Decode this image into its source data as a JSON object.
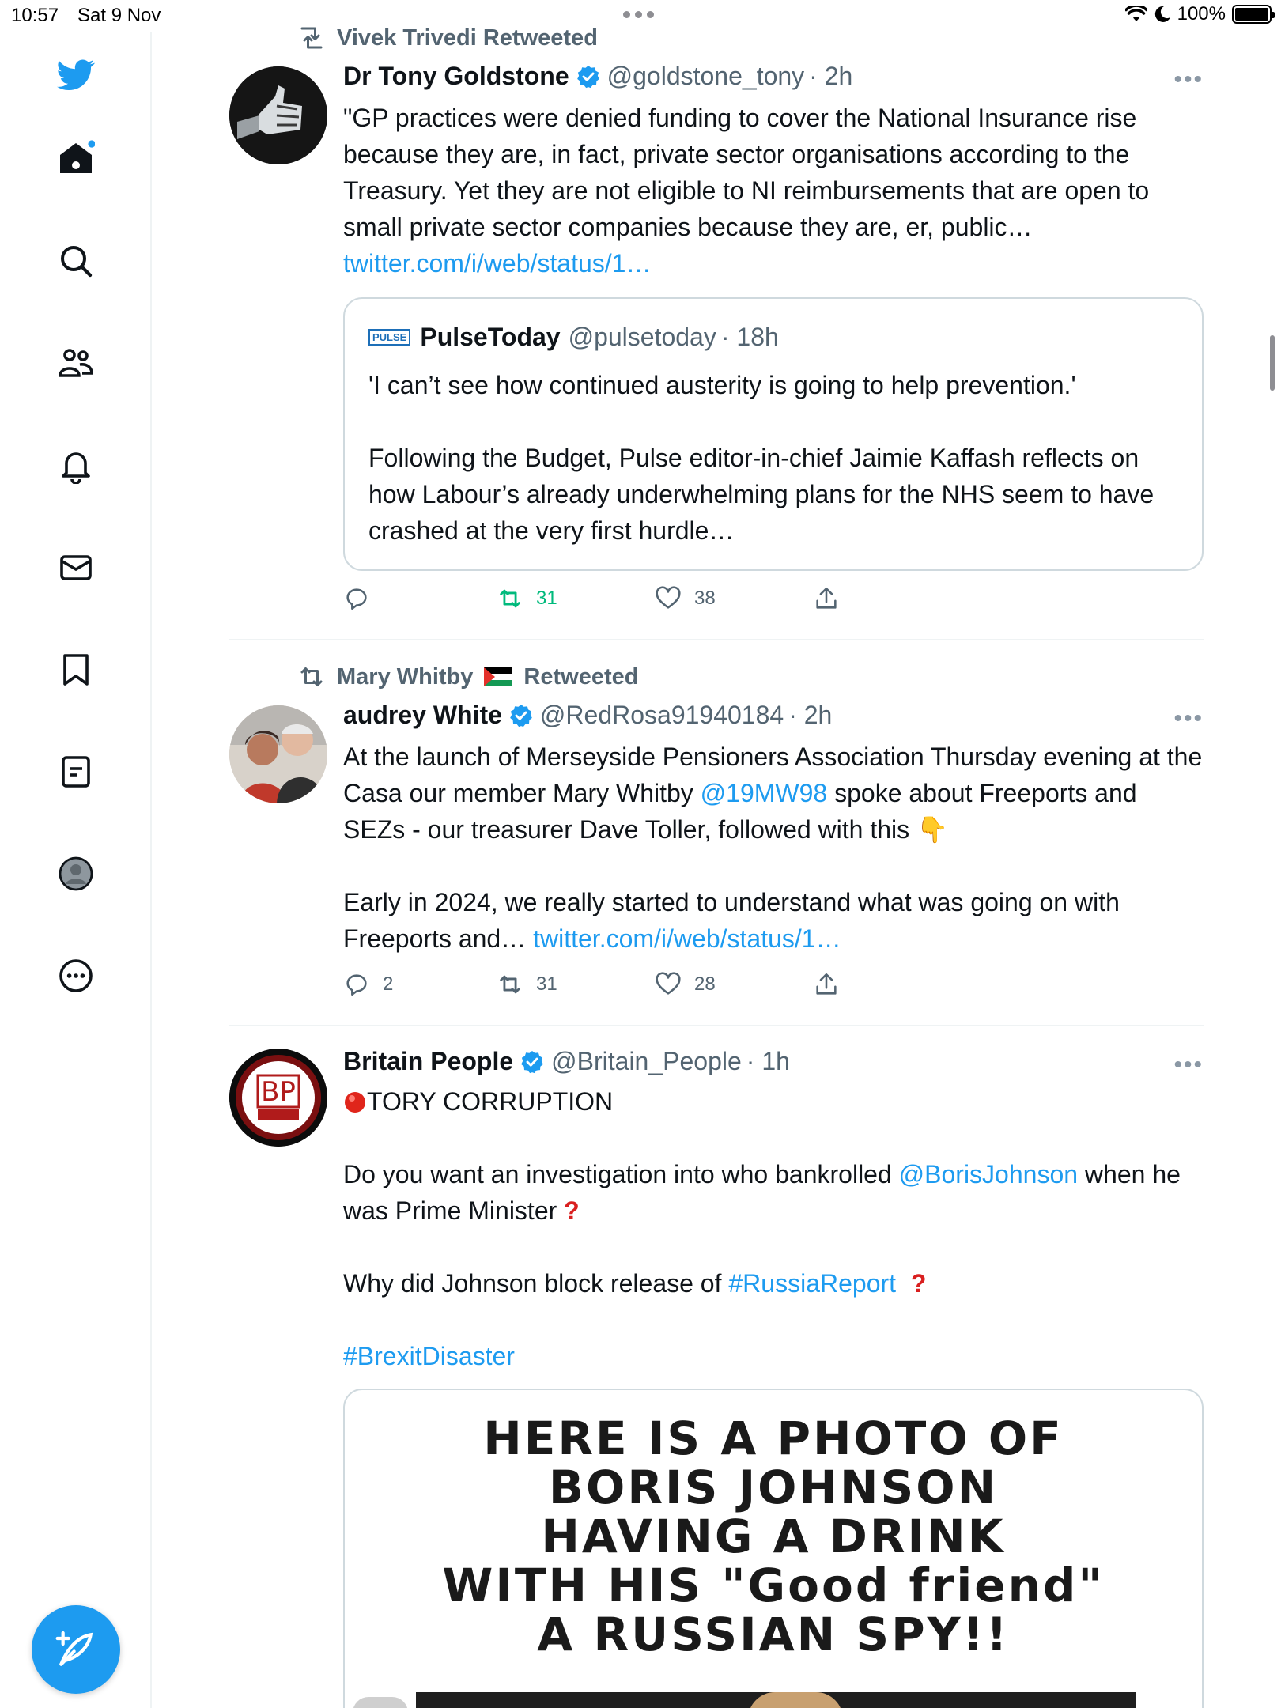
{
  "status_bar": {
    "time": "10:57",
    "date": "Sat 9 Nov",
    "battery": "100%"
  },
  "sidebar": {
    "items": [
      {
        "name": "twitter-logo",
        "label": ""
      },
      {
        "name": "home",
        "label": ""
      },
      {
        "name": "explore",
        "label": ""
      },
      {
        "name": "communities",
        "label": ""
      },
      {
        "name": "notifications",
        "label": ""
      },
      {
        "name": "messages",
        "label": ""
      },
      {
        "name": "bookmarks",
        "label": ""
      },
      {
        "name": "lists",
        "label": ""
      },
      {
        "name": "profile",
        "label": ""
      },
      {
        "name": "more",
        "label": ""
      }
    ],
    "accent": "#1d9bf0"
  },
  "tweets": [
    {
      "retweeted_by": "Vivek Trivedi Retweeted",
      "name": "Dr Tony Goldstone",
      "handle": "@goldstone_tony",
      "time": "· 2h",
      "text": "\"GP practices were denied funding to cover the National Insurance rise because they are, in fact, private sector organisations according to the Treasury. Yet they are not eligible to NI reimbursements that are open to small private sector companies because they are, er, public…",
      "link": "twitter.com/i/web/status/1…",
      "quote": {
        "logo": "PULSE",
        "name": "PulseToday",
        "handle": "@pulsetoday",
        "time": "· 18h",
        "text1": "'I can’t see how continued austerity is going to help prevention.'",
        "text2": "Following the Budget, Pulse editor-in-chief Jaimie Kaffash reflects on how Labour’s already underwhelming plans for the NHS seem to have crashed at the very first hurdle…"
      },
      "replies": "",
      "retweets": "31",
      "likes": "38"
    },
    {
      "retweeted_by": "Mary Whitby",
      "retweeted_suffix": "Retweeted",
      "name": "audrey White",
      "handle": "@RedRosa91940184",
      "time": "· 2h",
      "text_a": "At the launch of Merseyside Pensioners Association Thursday evening at the Casa our member Mary Whitby ",
      "mention": "@19MW98",
      "text_b": " spoke about Freeports and SEZs - our treasurer  Dave Toller, followed with this ",
      "emoji": "👇",
      "text_c": "Early in 2024, we really started to understand what was going on with Freeports and… ",
      "link": "twitter.com/i/web/status/1…",
      "replies": "2",
      "retweets": "31",
      "likes": "28"
    },
    {
      "name": "Britain People",
      "handle": "@Britain_People",
      "time": "· 1h",
      "avatar_text": "BP",
      "line1": "TORY CORRUPTION",
      "line2_a": "Do you want an investigation into who bankrolled ",
      "line2_mention": "@BorisJohnson",
      "line2_b": " when he was Prime Minister",
      "line3_a": "Why did Johnson block release of ",
      "line3_tag": "#RussiaReport",
      "line4_tag": "#BrexitDisaster",
      "media_lines": [
        "HERE IS A PHOTO OF",
        "BORIS JOHNSON",
        "HAVING A DRINK",
        "WITH HIS \"Good friend\"",
        "A RUSSIAN SPY!!"
      ]
    }
  ]
}
